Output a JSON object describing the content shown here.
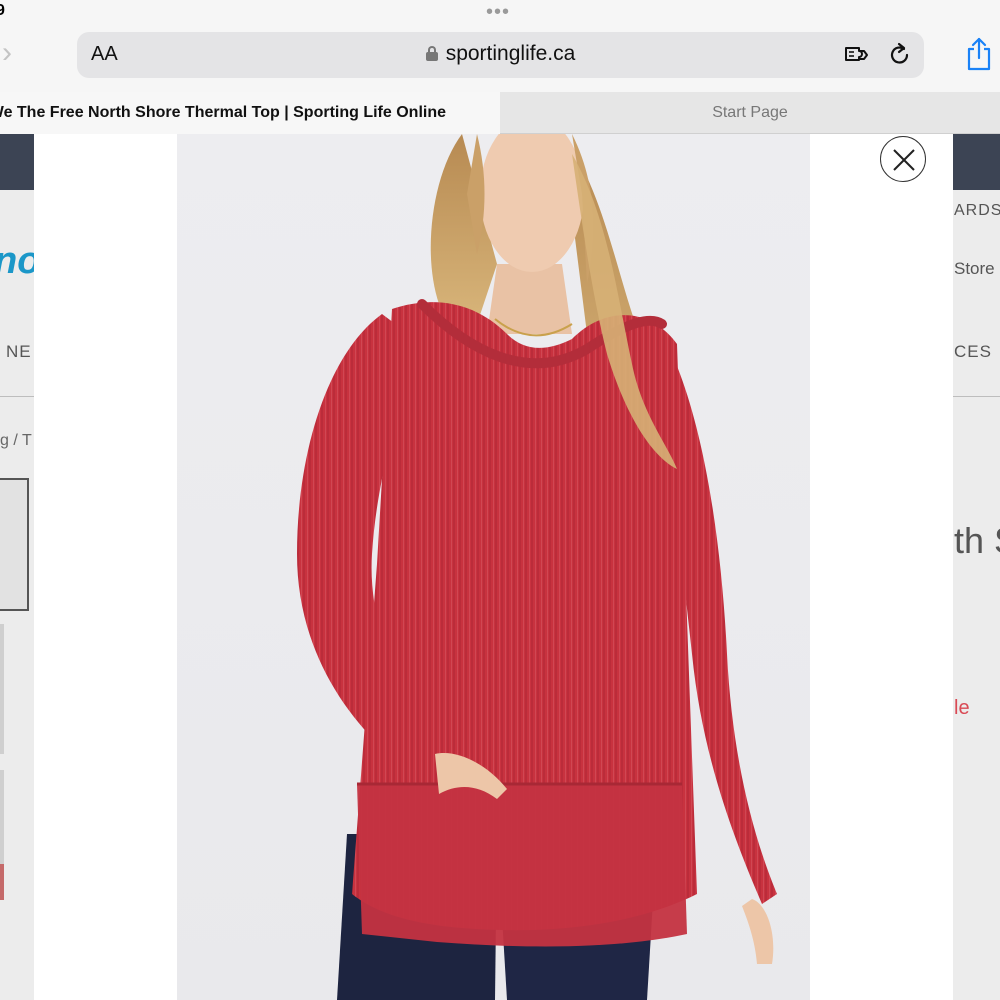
{
  "status_bar": {
    "time": "9"
  },
  "browser": {
    "text_size_label": "AA",
    "url": "sportinglife.ca",
    "tabs": [
      {
        "title": "We The Free North Shore Thermal Top | Sporting Life Online",
        "active": true
      },
      {
        "title": "Start Page",
        "active": false
      }
    ]
  },
  "background_page": {
    "logo_fragment": "no",
    "rewards_fragment": "ARDS",
    "store_fragment": "Store",
    "nav_left_fragment": "NE",
    "nav_right_fragment": "CES",
    "breadcrumb_fragment": "g / T",
    "product_title_fragment": "th S",
    "sale_fragment": "le"
  },
  "lightbox": {
    "image_subject": "model wearing red ribbed thermal long-sleeve top with dark jeans",
    "close_icon": "close-icon"
  },
  "colors": {
    "header_strip": "#3c4454",
    "logo_blue": "#1b97c8",
    "sale_red": "#d94a55",
    "top_red": "#c8323f",
    "jeans_navy": "#1d2440"
  }
}
